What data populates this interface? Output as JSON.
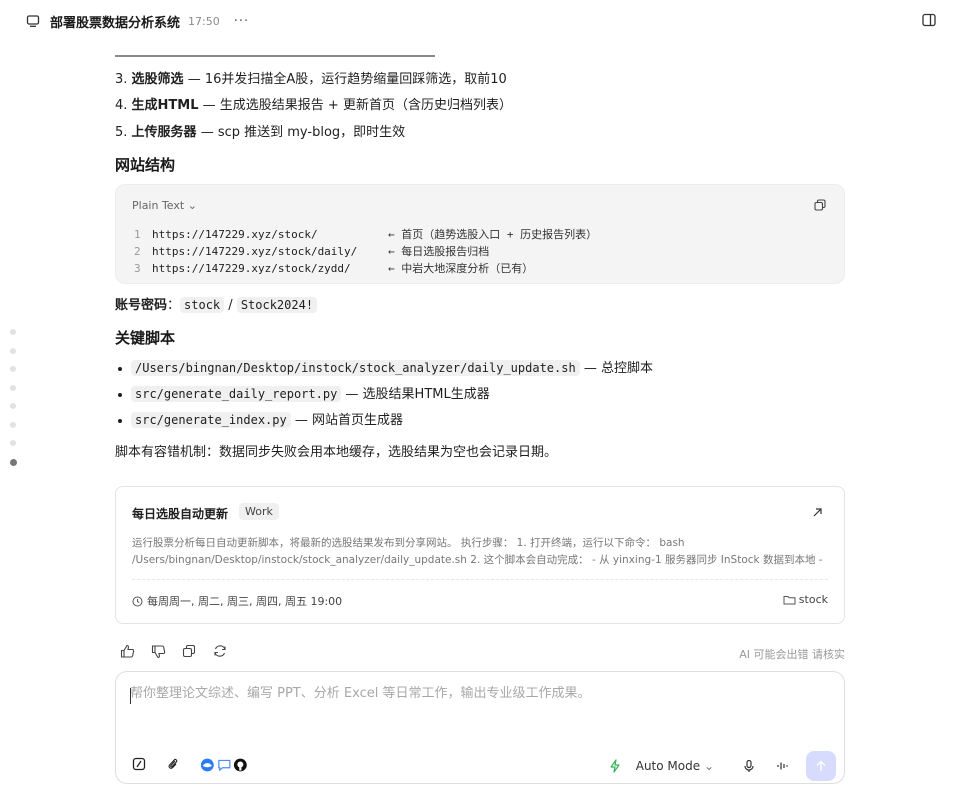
{
  "topbar": {
    "title": "部署股票数据分析系统",
    "time": "17:50",
    "more": "···"
  },
  "steps": [
    {
      "num": "3.",
      "bold": "选股筛选",
      "rest": " — 16并发扫描全A股，运行趋势缩量回踩筛选，取前10"
    },
    {
      "num": "4.",
      "bold": "生成HTML",
      "rest": " — 生成选股结果报告 + 更新首页（含历史归档列表）"
    },
    {
      "num": "5.",
      "bold": "上传服务器",
      "rest": " — scp 推送到 my-blog，即时生效"
    }
  ],
  "site_section": {
    "heading": "网站结构",
    "lang": "Plain Text",
    "lines": [
      {
        "n": "1",
        "url": "https://147229.xyz/stock/",
        "comment": "← 首页（趋势选股入口 + 历史报告列表）"
      },
      {
        "n": "2",
        "url": "https://147229.xyz/stock/daily/",
        "comment": "← 每日选股报告归档"
      },
      {
        "n": "3",
        "url": "https://147229.xyz/stock/zydd/",
        "comment": "← 中岩大地深度分析（已有）"
      }
    ]
  },
  "account": {
    "label": "账号密码",
    "colon": "：",
    "user": "stock",
    "sep": " / ",
    "password": "Stock2024!"
  },
  "scripts_section": {
    "heading": "关键脚本",
    "items": [
      {
        "code": "/Users/bingnan/Desktop/instock/stock_analyzer/daily_update.sh",
        "desc": " — 总控脚本"
      },
      {
        "code": "src/generate_daily_report.py",
        "desc": " — 选股结果HTML生成器"
      },
      {
        "code": "src/generate_index.py",
        "desc": " — 网站首页生成器"
      }
    ],
    "note": "脚本有容错机制：数据同步失败会用本地缓存，选股结果为空也会记录日期。"
  },
  "task_card": {
    "title": "每日选股自动更新",
    "tag": "Work",
    "description": "运行股票分析每日自动更新脚本，将最新的选股结果发布到分享网站。 执行步骤： 1. 打开终端，运行以下命令： bash /Users/bingnan/Desktop/instock/stock_analyzer/daily_update.sh 2. 这个脚本会自动完成： - 从 yinxing-1 服务器同步 InStock 数据到本地 - 自动检测最近交...",
    "schedule": "每周周一, 周二, 周三, 周四, 周五 19:00",
    "folder": "stock"
  },
  "disclaimer": "AI 可能会出错 请核实",
  "composer": {
    "placeholder": "帮你整理论文综述、编写 PPT、分析 Excel 等日常工作，输出专业级工作成果。",
    "mode_label": "Auto Mode"
  },
  "colors": {
    "send_button": "#d7dcff",
    "lightning": "#35b35a"
  },
  "icons": [
    "chat-bubble-icon",
    "sidebar-panel-icon",
    "copy-icon",
    "arrow-up-right-icon",
    "clock-icon",
    "folder-icon",
    "thumbs-up-icon",
    "thumbs-down-icon",
    "copy-icon",
    "refresh-icon",
    "slash-command-icon",
    "paperclip-icon",
    "lightning-icon",
    "chevron-down-icon",
    "microphone-icon",
    "voice-wave-icon",
    "send-arrow-icon"
  ]
}
